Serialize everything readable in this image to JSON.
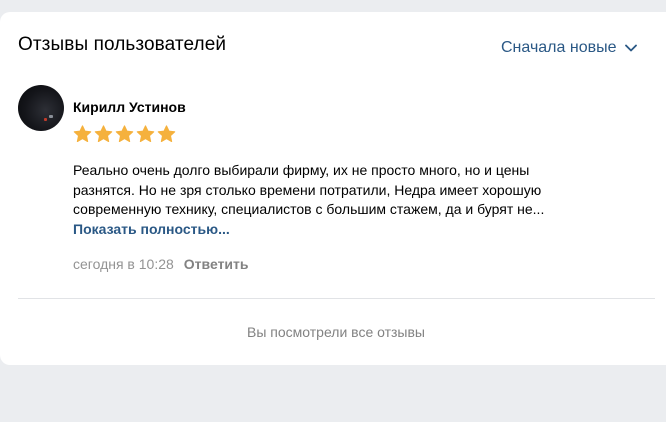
{
  "header": {
    "title": "Отзывы пользователей",
    "sort_label": "Сначала новые"
  },
  "review": {
    "author": "Кирилл Устинов",
    "rating": 5,
    "text_lines": [
      "Реально очень долго выбирали фирму, их не просто много, но и цены",
      "разнятся. Но не зря столько времени потратили, Недра имеет хорошую",
      "современную технику, специалистов с большим стажем, да и бурят не..."
    ],
    "show_more": "Показать полностью...",
    "timestamp": "сегодня в 10:28",
    "reply": "Ответить"
  },
  "footer": {
    "all_seen": "Вы посмотрели все отзывы"
  },
  "colors": {
    "link": "#2a5885",
    "star": "#f5b13d",
    "muted": "#828282"
  }
}
